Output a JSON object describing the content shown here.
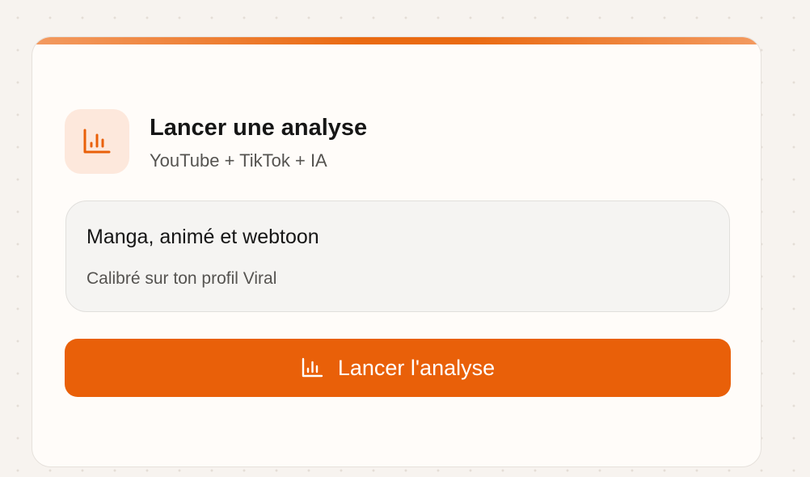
{
  "card": {
    "icon": "bar-chart-icon",
    "title": "Lancer une analyse",
    "subtitle": "YouTube + TikTok + IA"
  },
  "option": {
    "title": "Manga, animé et webtoon",
    "subtitle": "Calibré sur ton profil Viral"
  },
  "button": {
    "icon": "bar-chart-icon",
    "label": "Lancer l'analyse"
  },
  "colors": {
    "accent": "#e96009",
    "icon_bg": "#fde8dc",
    "card_bg": "#fffcf9",
    "option_bg": "#f5f4f2"
  }
}
